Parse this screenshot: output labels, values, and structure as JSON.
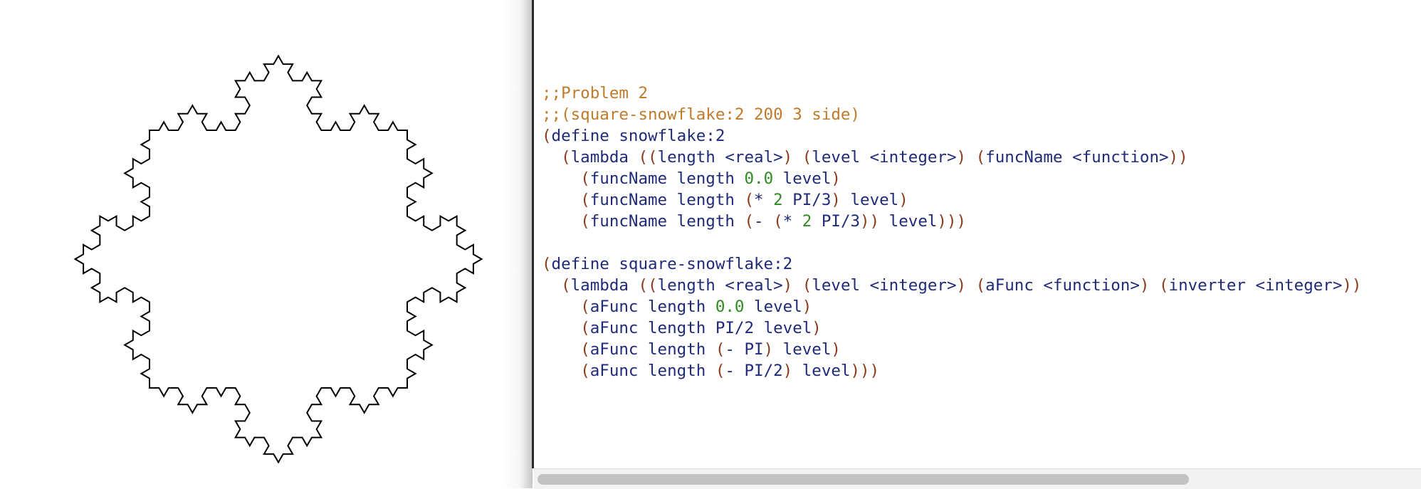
{
  "canvas": {
    "figure": "koch-square-snowflake",
    "stroke_color": "#000000"
  },
  "editor": {
    "lines": [
      [
        {
          "t": ";;Problem 2",
          "k": "comment"
        }
      ],
      [
        {
          "t": ";;(square-snowflake:2 200 3 side)",
          "k": "comment"
        }
      ],
      [
        {
          "t": "(",
          "k": "paren"
        },
        {
          "t": "define snowflake:2",
          "k": "sym"
        }
      ],
      [
        {
          "t": "  ",
          "k": "plain"
        },
        {
          "t": "(",
          "k": "paren"
        },
        {
          "t": "lambda ",
          "k": "sym"
        },
        {
          "t": "((",
          "k": "paren"
        },
        {
          "t": "length <real>",
          "k": "sym"
        },
        {
          "t": ") (",
          "k": "paren"
        },
        {
          "t": "level <integer>",
          "k": "sym"
        },
        {
          "t": ") (",
          "k": "paren"
        },
        {
          "t": "funcName <function>",
          "k": "sym"
        },
        {
          "t": "))",
          "k": "paren"
        }
      ],
      [
        {
          "t": "    ",
          "k": "plain"
        },
        {
          "t": "(",
          "k": "paren"
        },
        {
          "t": "funcName length ",
          "k": "sym"
        },
        {
          "t": "0.0",
          "k": "num"
        },
        {
          "t": " level",
          "k": "sym"
        },
        {
          "t": ")",
          "k": "paren"
        }
      ],
      [
        {
          "t": "    ",
          "k": "plain"
        },
        {
          "t": "(",
          "k": "paren"
        },
        {
          "t": "funcName length ",
          "k": "sym"
        },
        {
          "t": "(",
          "k": "paren"
        },
        {
          "t": "* ",
          "k": "sym"
        },
        {
          "t": "2",
          "k": "num"
        },
        {
          "t": " PI/3",
          "k": "sym"
        },
        {
          "t": ")",
          "k": "paren"
        },
        {
          "t": " level",
          "k": "sym"
        },
        {
          "t": ")",
          "k": "paren"
        }
      ],
      [
        {
          "t": "    ",
          "k": "plain"
        },
        {
          "t": "(",
          "k": "paren"
        },
        {
          "t": "funcName length ",
          "k": "sym"
        },
        {
          "t": "(",
          "k": "paren"
        },
        {
          "t": "- ",
          "k": "sym"
        },
        {
          "t": "(",
          "k": "paren"
        },
        {
          "t": "* ",
          "k": "sym"
        },
        {
          "t": "2",
          "k": "num"
        },
        {
          "t": " PI/3",
          "k": "sym"
        },
        {
          "t": "))",
          "k": "paren"
        },
        {
          "t": " level",
          "k": "sym"
        },
        {
          "t": ")))",
          "k": "paren"
        }
      ],
      [
        {
          "t": "",
          "k": "plain"
        }
      ],
      [
        {
          "t": "(",
          "k": "paren"
        },
        {
          "t": "define square-snowflake:2",
          "k": "sym"
        }
      ],
      [
        {
          "t": "  ",
          "k": "plain"
        },
        {
          "t": "(",
          "k": "paren"
        },
        {
          "t": "lambda ",
          "k": "sym"
        },
        {
          "t": "((",
          "k": "paren"
        },
        {
          "t": "length <real>",
          "k": "sym"
        },
        {
          "t": ") (",
          "k": "paren"
        },
        {
          "t": "level <integer>",
          "k": "sym"
        },
        {
          "t": ") (",
          "k": "paren"
        },
        {
          "t": "aFunc <function>",
          "k": "sym"
        },
        {
          "t": ") (",
          "k": "paren"
        },
        {
          "t": "inverter <integer>",
          "k": "sym"
        },
        {
          "t": "))",
          "k": "paren"
        }
      ],
      [
        {
          "t": "    ",
          "k": "plain"
        },
        {
          "t": "(",
          "k": "paren"
        },
        {
          "t": "aFunc length ",
          "k": "sym"
        },
        {
          "t": "0.0",
          "k": "num"
        },
        {
          "t": " level",
          "k": "sym"
        },
        {
          "t": ")",
          "k": "paren"
        }
      ],
      [
        {
          "t": "    ",
          "k": "plain"
        },
        {
          "t": "(",
          "k": "paren"
        },
        {
          "t": "aFunc length PI/2 level",
          "k": "sym"
        },
        {
          "t": ")",
          "k": "paren"
        }
      ],
      [
        {
          "t": "    ",
          "k": "plain"
        },
        {
          "t": "(",
          "k": "paren"
        },
        {
          "t": "aFunc length ",
          "k": "sym"
        },
        {
          "t": "(",
          "k": "paren"
        },
        {
          "t": "- PI",
          "k": "sym"
        },
        {
          "t": ")",
          "k": "paren"
        },
        {
          "t": " level",
          "k": "sym"
        },
        {
          "t": ")",
          "k": "paren"
        }
      ],
      [
        {
          "t": "    ",
          "k": "plain"
        },
        {
          "t": "(",
          "k": "paren"
        },
        {
          "t": "aFunc length ",
          "k": "sym"
        },
        {
          "t": "(",
          "k": "paren"
        },
        {
          "t": "- PI/2",
          "k": "sym"
        },
        {
          "t": ")",
          "k": "paren"
        },
        {
          "t": " level",
          "k": "sym"
        },
        {
          "t": ")))",
          "k": "paren"
        }
      ]
    ]
  },
  "scrollbar": {
    "orientation": "horizontal",
    "thumb_fraction": 0.74
  },
  "colors": {
    "comment": "#c07a2a",
    "paren": "#8b3a1a",
    "symbol": "#1f2a78",
    "number": "#2e8b1e",
    "divider": "#2a2a2a"
  }
}
